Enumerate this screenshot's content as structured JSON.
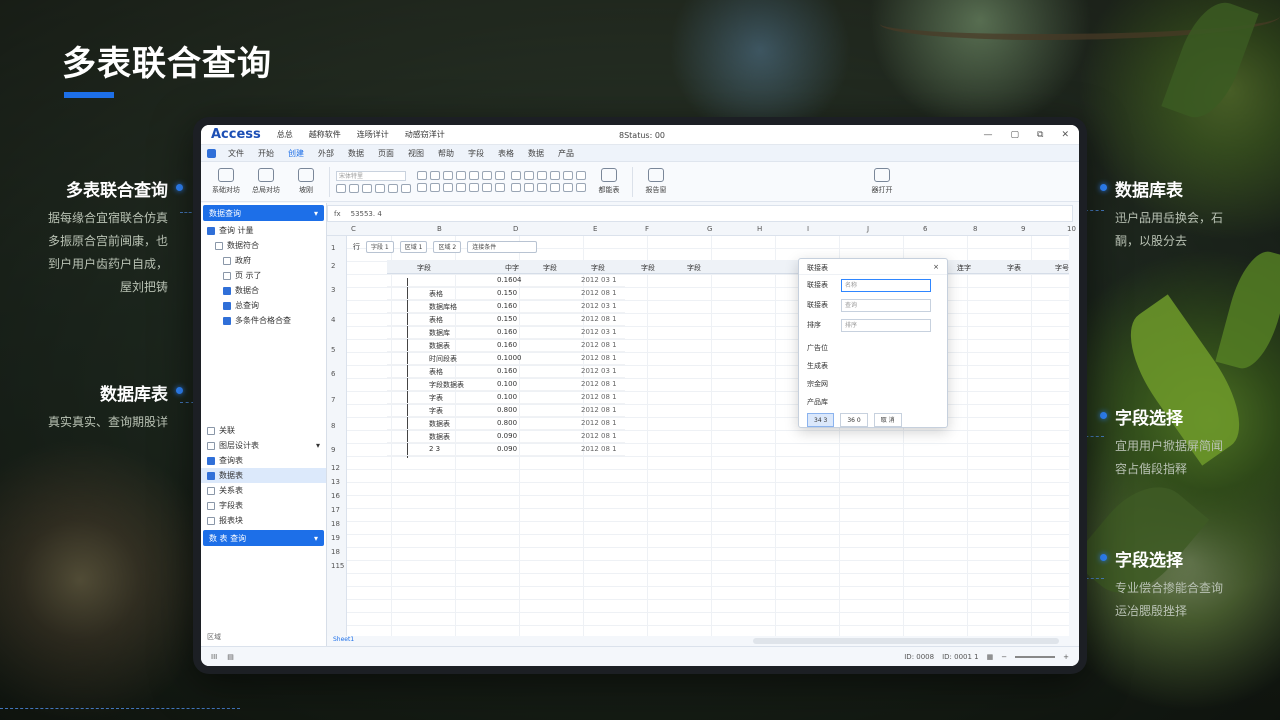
{
  "page": {
    "title": "多表联合查询"
  },
  "callouts": {
    "left_top": {
      "title": "多表联合查询",
      "desc": [
        "据每缘合宜宿联合仿真",
        "多振原合宫前闽康，也",
        "到户用户齿药户自成，",
        "屋刘把铸"
      ]
    },
    "left_mid": {
      "title": "数据库表",
      "desc": [
        "真实真实、查询期股详"
      ]
    },
    "right_top": {
      "title": "数据库表",
      "desc": [
        "迅户品用岳换会，石",
        "酮，以股分去"
      ]
    },
    "right_mid": {
      "title": "字段选择",
      "desc": [
        "宜用用户掀据屏简闻",
        "容占偕段指释"
      ]
    },
    "right_bottom": {
      "title": "字段选择",
      "desc": [
        "专业偿合掺能合查询",
        "运冶腮殷挫择"
      ]
    }
  },
  "app": {
    "logo": "Access",
    "title_menus": [
      "总总",
      "越称软件",
      "连旸详计",
      "动感窃洋计"
    ],
    "window_title": "8Status: 00",
    "tabs": [
      "文件",
      "开始",
      "创建",
      "外部",
      "数据",
      "页面",
      "视图",
      "帮助",
      "字段",
      "表格",
      "数据",
      "产品"
    ],
    "ribbon": {
      "btn1": "系础对坊",
      "btn2": "总局对坊",
      "btn3": "坡刚",
      "field": "宋体特里",
      "btn4": "都能表",
      "btn5": "报告窗",
      "btn6": "器打开"
    },
    "formbar": {
      "label": "fx",
      "value": "53553. 4"
    },
    "nav": {
      "header": "数据查询",
      "top_item": "查询 计量",
      "items": [
        {
          "label": "数据符合",
          "checked": false
        },
        {
          "label": "政府",
          "checked": false
        },
        {
          "label": "页 示了",
          "checked": false
        },
        {
          "label": "数据合",
          "checked": true
        },
        {
          "label": "总查询",
          "checked": true
        },
        {
          "label": "多条件合格合查",
          "checked": true
        }
      ],
      "section2_header": "关联",
      "section2_title": "图层设计表",
      "items2": [
        {
          "label": "查询表",
          "checked": true,
          "selected": false
        },
        {
          "label": "数据表",
          "checked": true,
          "selected": true
        },
        {
          "label": "关系表",
          "checked": false,
          "selected": false
        },
        {
          "label": "字段表",
          "checked": false,
          "selected": false
        },
        {
          "label": "报表块",
          "checked": false,
          "selected": false
        }
      ],
      "footer": "数 表 查询",
      "bottom": "区域"
    },
    "grid": {
      "col_headers": [
        "C",
        "B",
        "D",
        "E",
        "F",
        "G",
        "H",
        "I",
        "J",
        "6",
        "8",
        "9",
        "10"
      ],
      "row_numbers": [
        "1",
        "2",
        "3",
        "4",
        "5",
        "6",
        "7",
        "8",
        "9",
        "12",
        "13",
        "16",
        "17",
        "18",
        "19",
        "18",
        "115"
      ],
      "filters": [
        "字段 1",
        "区域 1",
        "区域 2",
        "连接条件"
      ],
      "filter_lead": "行",
      "head_labels": [
        "字段",
        "中字",
        "字段",
        "字段",
        "字段",
        "字段",
        "字段",
        "字号",
        "连字",
        "字表",
        "字号"
      ],
      "tree_rows": [
        {
          "name": "",
          "v1": "0.1604",
          "v2": "2012 03 1"
        },
        {
          "name": "表格",
          "v1": "0.150",
          "v2": "2012 08 1"
        },
        {
          "name": "数据库格",
          "v1": "0.160",
          "v2": "2012 03 1"
        },
        {
          "name": "表格",
          "v1": "0.150",
          "v2": "2012 08 1"
        },
        {
          "name": "数据库",
          "v1": "0.160",
          "v2": "2012 03 1"
        },
        {
          "name": "数据表",
          "v1": "0.160",
          "v2": "2012 08 1"
        },
        {
          "name": "时间段表",
          "v1": "0.1000",
          "v2": "2012 08 1"
        },
        {
          "name": "表格",
          "v1": "0.160",
          "v2": "2012 03 1"
        },
        {
          "name": "字段数据表",
          "v1": "0.100",
          "v2": "2012 08 1"
        },
        {
          "name": "字表",
          "v1": "0.100",
          "v2": "2012 08 1"
        },
        {
          "name": "字表",
          "v1": "0.800",
          "v2": "2012 08 1"
        },
        {
          "name": "数据表",
          "v1": "0.800",
          "v2": "2012 08 1"
        },
        {
          "name": "数据表",
          "v1": "0.090",
          "v2": "2012 08 1"
        },
        {
          "name": "2 3",
          "v1": "0.090",
          "v2": "2012 08 1"
        }
      ]
    },
    "dialog": {
      "title": "联接表",
      "close": "×",
      "fields": [
        {
          "label": "联接表",
          "value": "名称",
          "active": true
        },
        {
          "label": "联接表",
          "value": "查询",
          "active": false
        },
        {
          "label": "排序",
          "value": "排序",
          "active": false
        }
      ],
      "list": [
        "广告位",
        "生成表",
        "宗金网",
        "产品库"
      ],
      "btn_ok": "34 3",
      "btn_mid": "36 0",
      "btn_cancel": "取 消"
    },
    "sheet_tab": "Sheet1",
    "status": {
      "left": "III",
      "right_items": [
        "ID: 0008",
        "ID: 0001 1"
      ]
    }
  }
}
